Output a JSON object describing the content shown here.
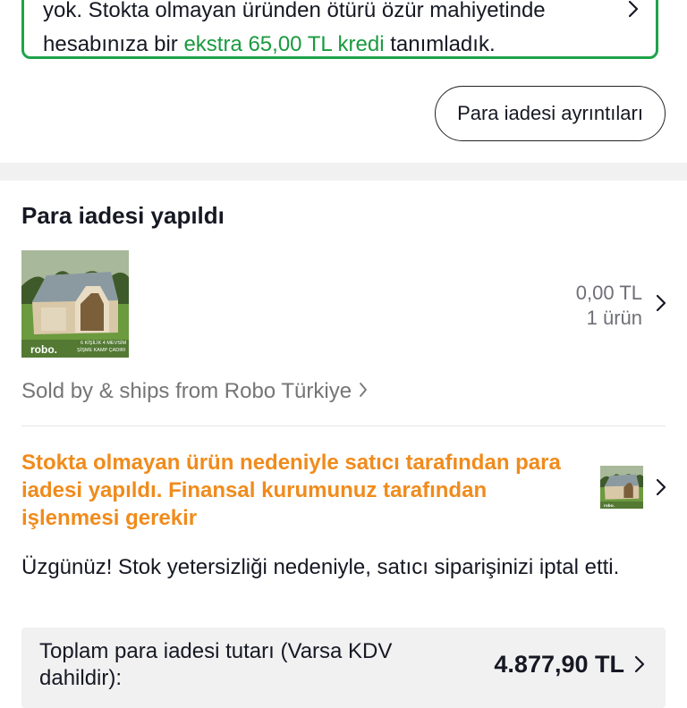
{
  "notice": {
    "line1": "yok. Stokta olmayan üründen ötürü özür mahiyetinde",
    "line2_prefix": "hesabınıza bir ",
    "line2_highlight": "ekstra 65,00 TL kredi",
    "line2_suffix": " tanımladık.",
    "chevron_icon": "chevron-right-icon"
  },
  "refund_details_button": "Para iadesi ayrıntıları",
  "section": {
    "title": "Para iadesi yapıldı",
    "product": {
      "brand_logo": "robo.",
      "thumb_caption_line1": "6 KİŞİLİK 4 MEVSİM",
      "thumb_caption_line2": "ŞİŞME KAMP ÇADIRI",
      "price": "0,00 TL",
      "count": "1 ürün"
    },
    "seller": "Sold by & ships from Robo Türkiye"
  },
  "refund_status": {
    "message": "Stokta olmayan ürün nedeniyle satıcı tarafından para iadesi yapıldı. Finansal kurumunuz tarafından işlenmesi gerekir"
  },
  "apology": "Üzgünüz! Stok yetersizliği nedeniyle, satıcı siparişinizi iptal etti.",
  "total": {
    "label": "Toplam para iadesi tutarı (Varsa KDV dahildir):",
    "value": "4.877,90 TL"
  },
  "colors": {
    "accent_green": "#1a9a3f",
    "status_orange": "#f08b1c"
  }
}
